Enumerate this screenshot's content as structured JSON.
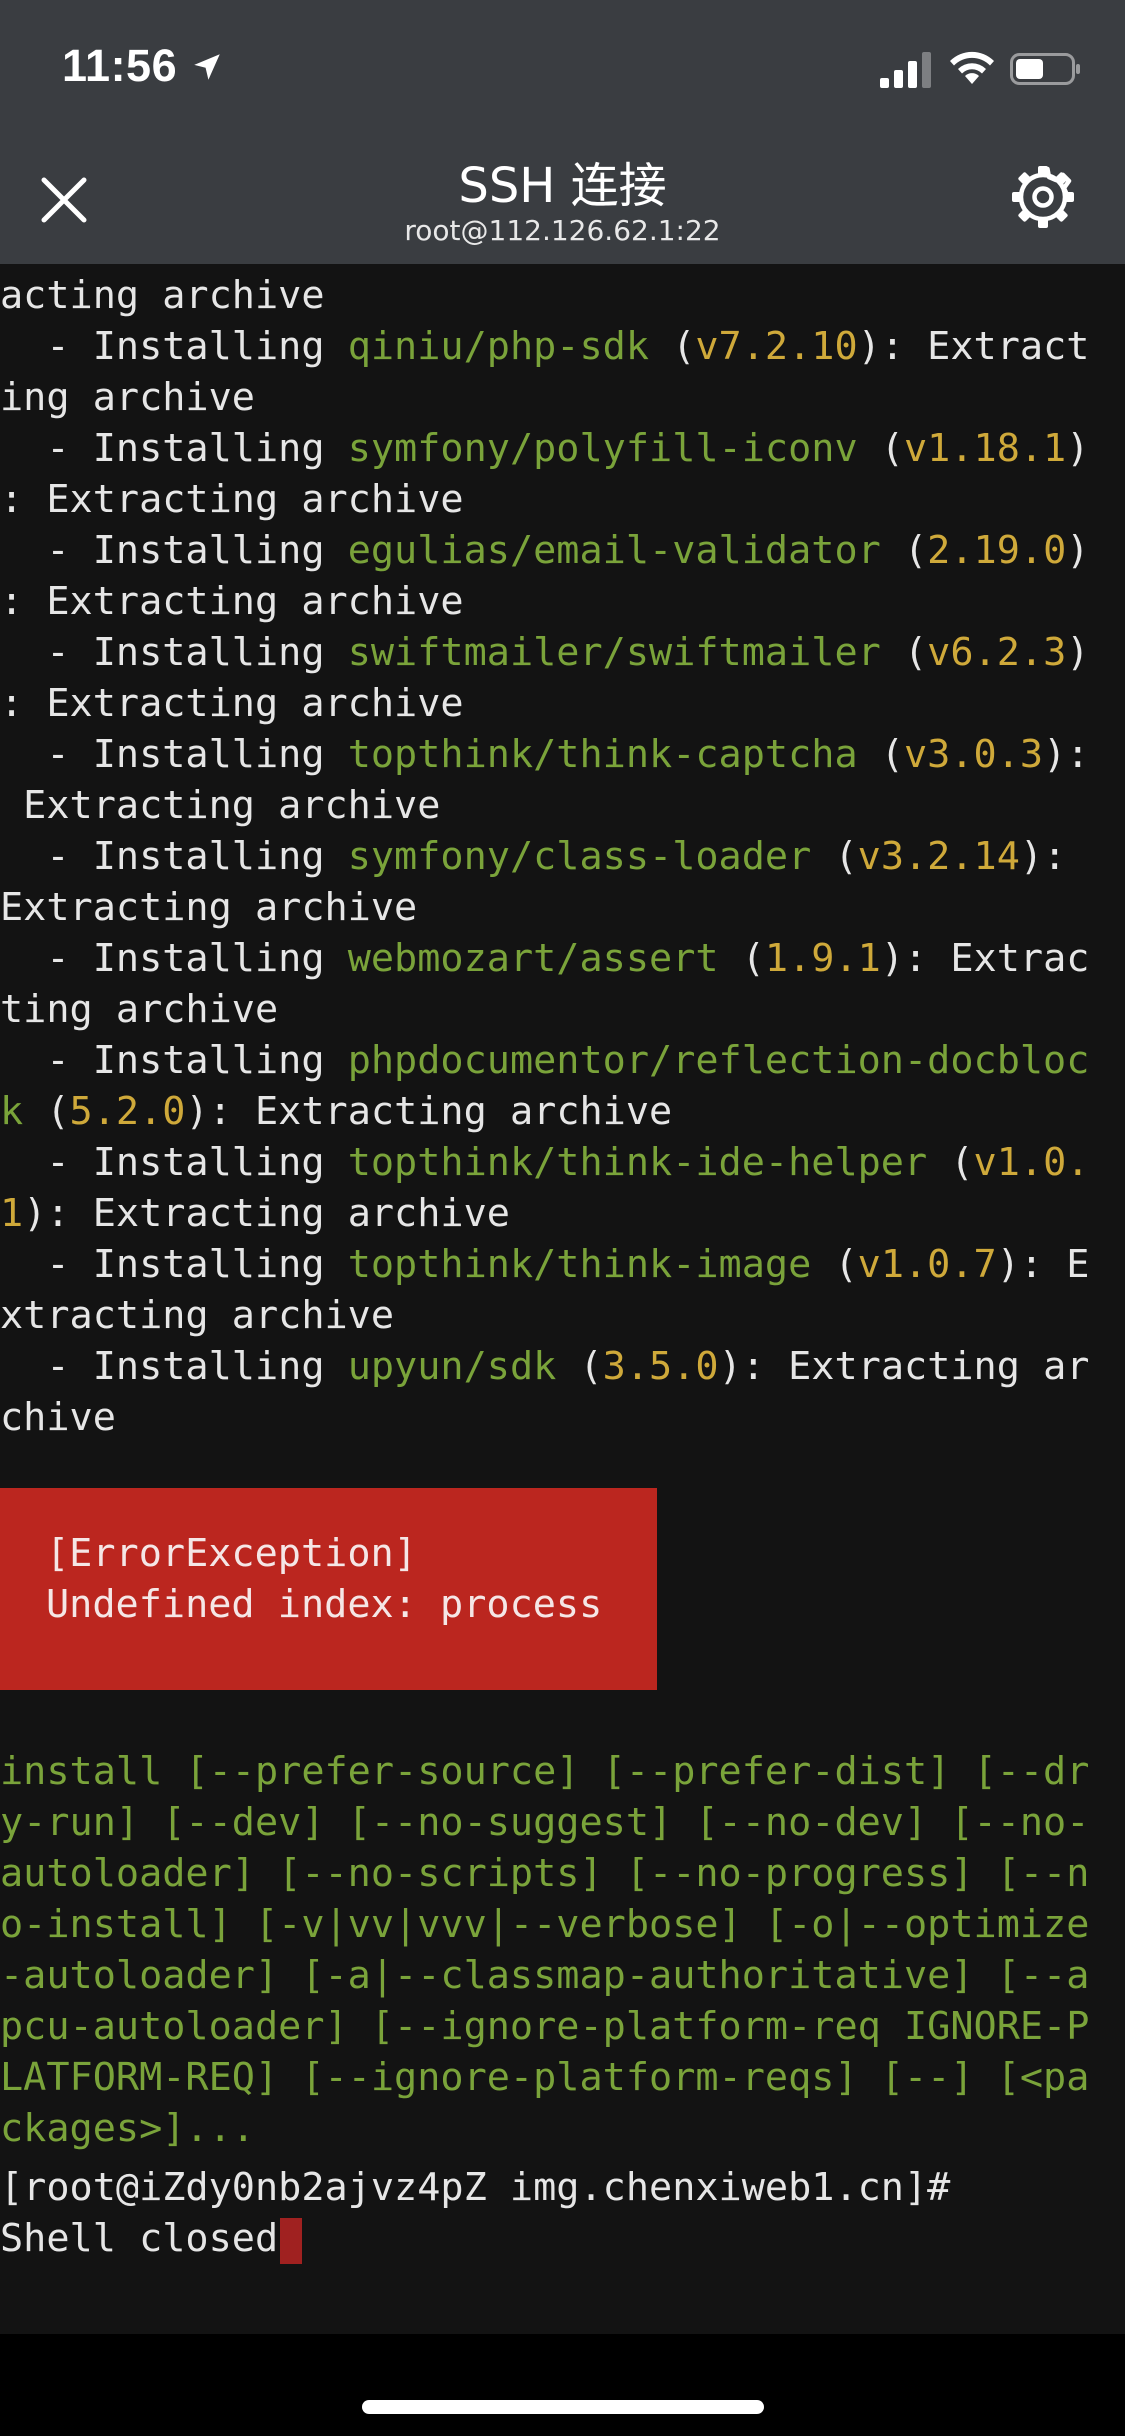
{
  "status_bar": {
    "time": "11:56",
    "icons": [
      "location-arrow-icon",
      "cellular-signal-icon",
      "wifi-icon",
      "battery-icon"
    ]
  },
  "nav": {
    "title": "SSH 连接",
    "subtitle": "root@112.126.62.1:22",
    "close_icon": "close-icon",
    "settings_icon": "gear-icon"
  },
  "colors": {
    "bar_bg": "#3a3d41",
    "terminal_bg": "#131313",
    "package_green": "#7aa33a",
    "version_yellow": "#cfa93a",
    "error_red": "#bb261f"
  },
  "terminal": {
    "lines": [
      [
        {
          "t": "acting archive",
          "c": "w"
        }
      ],
      [
        {
          "t": "  - Installing ",
          "c": "w"
        },
        {
          "t": "qiniu/php-sdk",
          "c": "g"
        },
        {
          "t": " (",
          "c": "w"
        },
        {
          "t": "v7.2.10",
          "c": "y"
        },
        {
          "t": "): Extract",
          "c": "w"
        }
      ],
      [
        {
          "t": "ing archive",
          "c": "w"
        }
      ],
      [
        {
          "t": "  - Installing ",
          "c": "w"
        },
        {
          "t": "symfony/polyfill-iconv",
          "c": "g"
        },
        {
          "t": " (",
          "c": "w"
        },
        {
          "t": "v1.18.1",
          "c": "y"
        },
        {
          "t": ")",
          "c": "w"
        }
      ],
      [
        {
          "t": ": Extracting archive",
          "c": "w"
        }
      ],
      [
        {
          "t": "  - Installing ",
          "c": "w"
        },
        {
          "t": "egulias/email-validator",
          "c": "g"
        },
        {
          "t": " (",
          "c": "w"
        },
        {
          "t": "2.19.0",
          "c": "y"
        },
        {
          "t": ")",
          "c": "w"
        }
      ],
      [
        {
          "t": ": Extracting archive",
          "c": "w"
        }
      ],
      [
        {
          "t": "  - Installing ",
          "c": "w"
        },
        {
          "t": "swiftmailer/swiftmailer",
          "c": "g"
        },
        {
          "t": " (",
          "c": "w"
        },
        {
          "t": "v6.2.3",
          "c": "y"
        },
        {
          "t": ")",
          "c": "w"
        }
      ],
      [
        {
          "t": ": Extracting archive",
          "c": "w"
        }
      ],
      [
        {
          "t": "  - Installing ",
          "c": "w"
        },
        {
          "t": "topthink/think-captcha",
          "c": "g"
        },
        {
          "t": " (",
          "c": "w"
        },
        {
          "t": "v3.0.3",
          "c": "y"
        },
        {
          "t": "):",
          "c": "w"
        }
      ],
      [
        {
          "t": " Extracting archive",
          "c": "w"
        }
      ],
      [
        {
          "t": "  - Installing ",
          "c": "w"
        },
        {
          "t": "symfony/class-loader",
          "c": "g"
        },
        {
          "t": " (",
          "c": "w"
        },
        {
          "t": "v3.2.14",
          "c": "y"
        },
        {
          "t": "):",
          "c": "w"
        }
      ],
      [
        {
          "t": "Extracting archive",
          "c": "w"
        }
      ],
      [
        {
          "t": "  - Installing ",
          "c": "w"
        },
        {
          "t": "webmozart/assert",
          "c": "g"
        },
        {
          "t": " (",
          "c": "w"
        },
        {
          "t": "1.9.1",
          "c": "y"
        },
        {
          "t": "): Extrac",
          "c": "w"
        }
      ],
      [
        {
          "t": "ting archive",
          "c": "w"
        }
      ],
      [
        {
          "t": "  - Installing ",
          "c": "w"
        },
        {
          "t": "phpdocumentor/reflection-docbloc",
          "c": "g"
        }
      ],
      [
        {
          "t": "k",
          "c": "g"
        },
        {
          "t": " (",
          "c": "w"
        },
        {
          "t": "5.2.0",
          "c": "y"
        },
        {
          "t": "): Extracting archive",
          "c": "w"
        }
      ],
      [
        {
          "t": "  - Installing ",
          "c": "w"
        },
        {
          "t": "topthink/think-ide-helper",
          "c": "g"
        },
        {
          "t": " (",
          "c": "w"
        },
        {
          "t": "v1.0.",
          "c": "y"
        }
      ],
      [
        {
          "t": "1",
          "c": "y"
        },
        {
          "t": "): Extracting archive",
          "c": "w"
        }
      ],
      [
        {
          "t": "  - Installing ",
          "c": "w"
        },
        {
          "t": "topthink/think-image",
          "c": "g"
        },
        {
          "t": " (",
          "c": "w"
        },
        {
          "t": "v1.0.7",
          "c": "y"
        },
        {
          "t": "): E",
          "c": "w"
        }
      ],
      [
        {
          "t": "xtracting archive",
          "c": "w"
        }
      ],
      [
        {
          "t": "  - Installing ",
          "c": "w"
        },
        {
          "t": "upyun/sdk",
          "c": "g"
        },
        {
          "t": " (",
          "c": "w"
        },
        {
          "t": "3.5.0",
          "c": "y"
        },
        {
          "t": "): Extracting ar",
          "c": "w"
        }
      ],
      [
        {
          "t": "chive",
          "c": "w"
        }
      ]
    ],
    "error": {
      "type": "[ErrorException]",
      "message": "Undefined index: process"
    },
    "usage": [
      "install [--prefer-source] [--prefer-dist] [--dr",
      "y-run] [--dev] [--no-suggest] [--no-dev] [--no-",
      "autoloader] [--no-scripts] [--no-progress] [--n",
      "o-install] [-v|vv|vvv|--verbose] [-o|--optimize",
      "-autoloader] [-a|--classmap-authoritative] [--a",
      "pcu-autoloader] [--ignore-platform-req IGNORE-P",
      "LATFORM-REQ] [--ignore-platform-reqs] [--] [<pa",
      "ckages>]..."
    ],
    "prompt": "[root@iZdy0nb2ajvz4pZ img.chenxiweb1.cn]#",
    "shell_closed": "Shell closed"
  }
}
